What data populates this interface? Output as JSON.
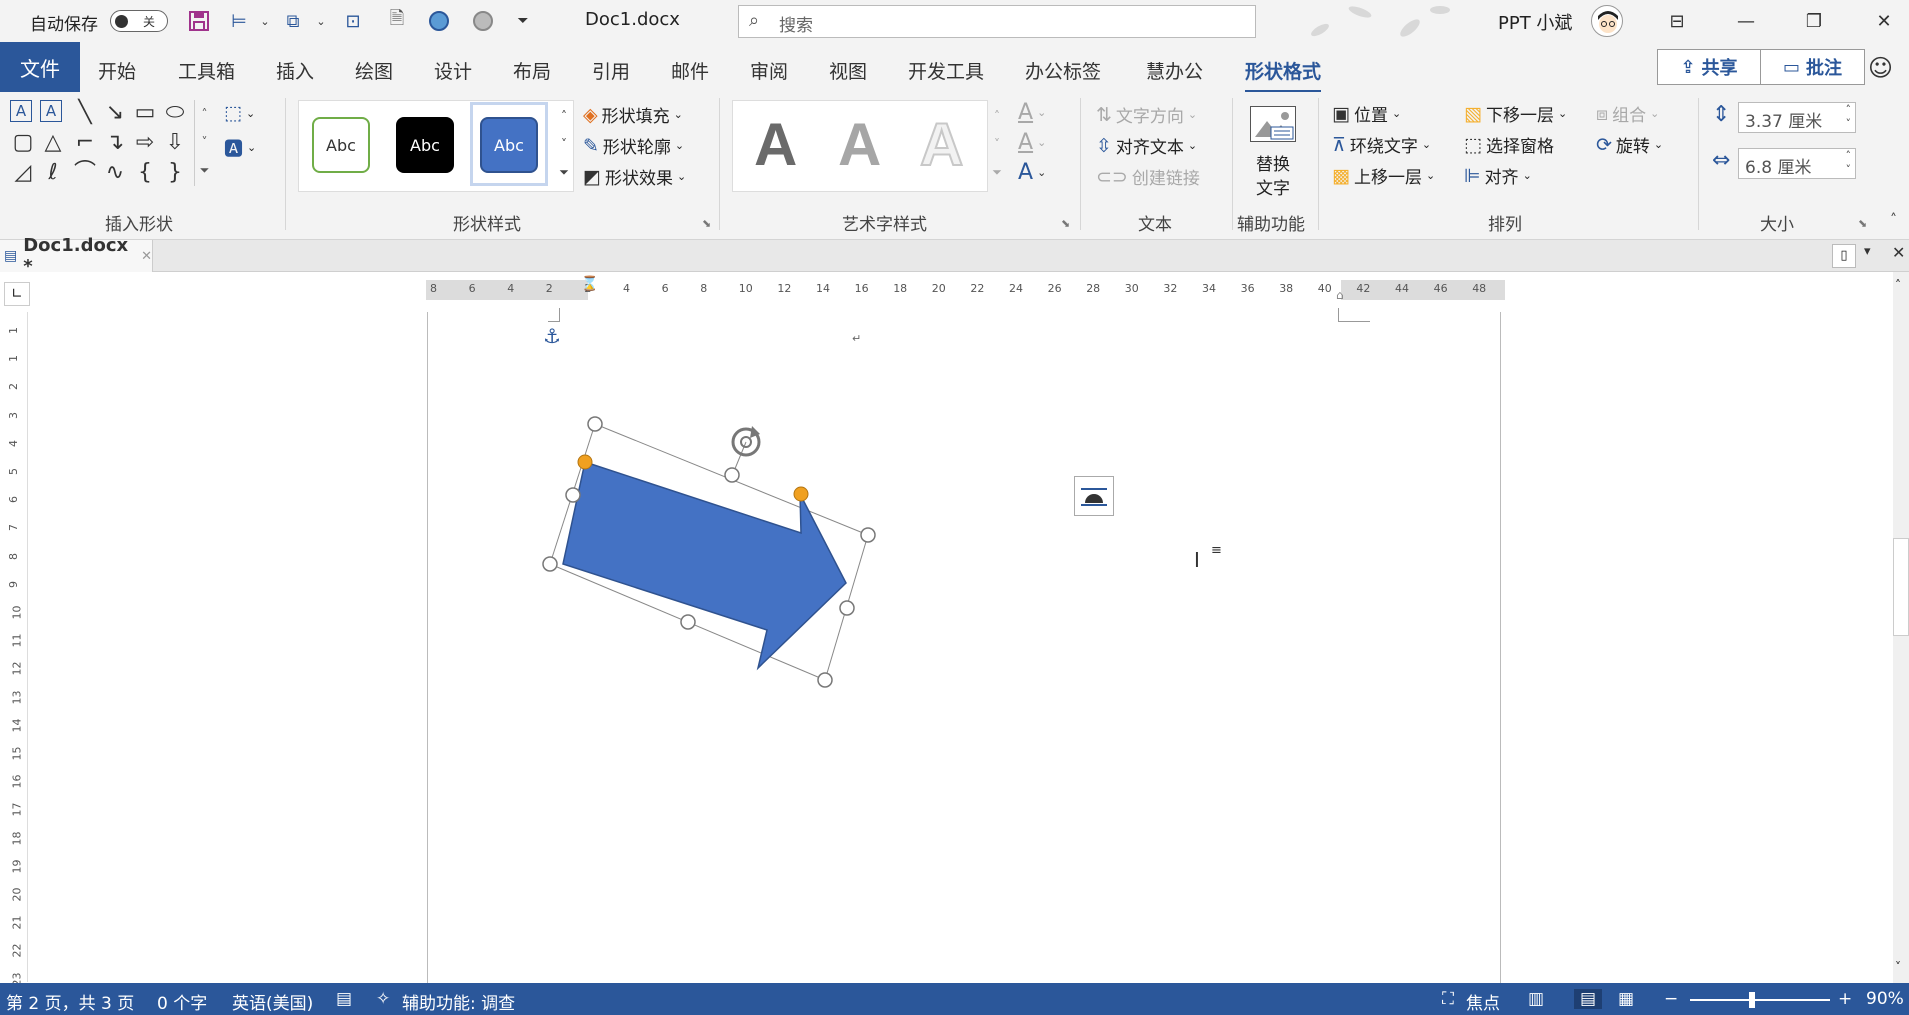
{
  "titlebar": {
    "autosave_label": "自动保存",
    "autosave_state": "关",
    "doc_title": "Doc1.docx",
    "search_placeholder": "搜索",
    "user_name": "PPT 小斌"
  },
  "tabs": [
    "文件",
    "开始",
    "工具箱",
    "插入",
    "绘图",
    "设计",
    "布局",
    "引用",
    "邮件",
    "审阅",
    "视图",
    "开发工具",
    "办公标签",
    "慧办公",
    "形状格式"
  ],
  "active_tab": "形状格式",
  "top_buttons": {
    "share": "共享",
    "comments": "批注"
  },
  "ribbon": {
    "groups": {
      "insert_shapes": "插入形状",
      "shape_styles": "形状样式",
      "wordart_styles": "艺术字样式",
      "text": "文本",
      "accessibility": "辅助功能",
      "arrange": "排列",
      "size": "大小"
    },
    "style_sample": "Abc",
    "wordart_sample": "A",
    "shape_fill": "形状填充",
    "shape_outline": "形状轮廓",
    "shape_effects": "形状效果",
    "text_direction": "文字方向",
    "align_text": "对齐文本",
    "create_link": "创建链接",
    "alt_text_1": "替换",
    "alt_text_2": "文字",
    "position": "位置",
    "wrap_text": "环绕文字",
    "bring_forward": "上移一层",
    "send_backward": "下移一层",
    "selection_pane": "选择窗格",
    "align": "对齐",
    "group": "组合",
    "rotate": "旋转",
    "height": "3.37 厘米",
    "width": "6.8 厘米"
  },
  "doc_tab": {
    "name": "Doc1.docx *"
  },
  "ruler_h": [
    "8",
    "6",
    "4",
    "2",
    "2",
    "4",
    "6",
    "8",
    "10",
    "12",
    "14",
    "16",
    "18",
    "20",
    "22",
    "24",
    "26",
    "28",
    "30",
    "32",
    "34",
    "36",
    "38",
    "40",
    "42",
    "44",
    "46",
    "48"
  ],
  "ruler_v": [
    "1",
    "1",
    "2",
    "3",
    "4",
    "5",
    "6",
    "7",
    "8",
    "9",
    "10",
    "11",
    "12",
    "13",
    "14",
    "15",
    "16",
    "17",
    "18",
    "19",
    "20",
    "21",
    "22",
    "23"
  ],
  "status": {
    "page": "第 2 页，共 3 页",
    "words": "0 个字",
    "language": "英语(美国)",
    "accessibility": "辅助功能: 调查",
    "focus": "焦点",
    "zoom": "90%"
  },
  "colors": {
    "accent": "#2b579a",
    "shape_fill": "#4472c4",
    "handle_yellow": "#f0a020"
  },
  "icons": [
    "save-icon",
    "search-icon",
    "avatar",
    "share-icon",
    "comment-icon",
    "smiley-icon",
    "anchor-icon",
    "rotate-handle-icon",
    "layout-options-icon"
  ]
}
